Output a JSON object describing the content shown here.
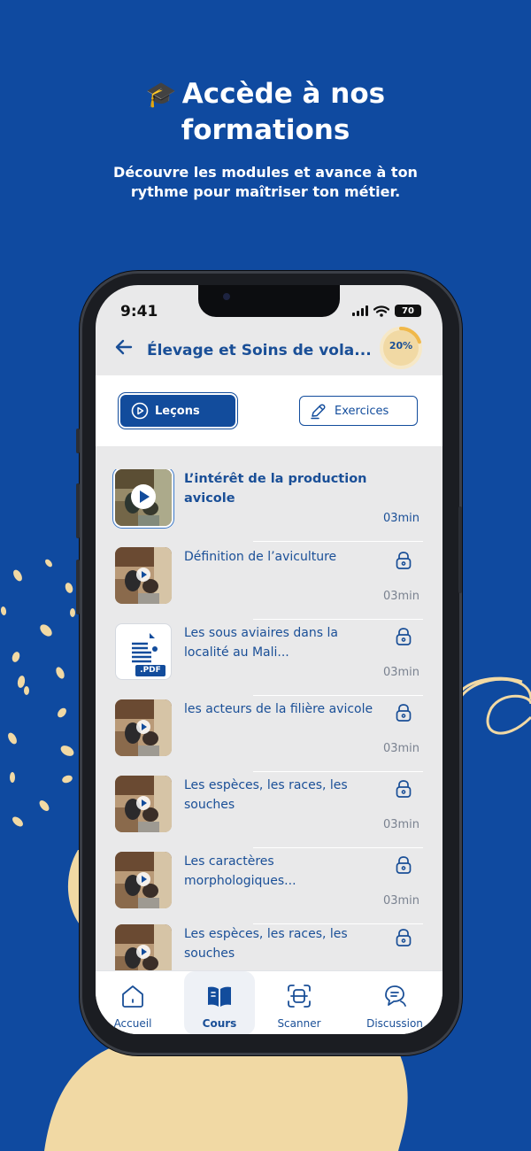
{
  "hero": {
    "icon": "graduation-cap-icon",
    "title_line1": "Accède à nos",
    "title_line2": "formations",
    "subtitle": "Découvre les modules et avance à ton rythme pour maîtriser ton métier."
  },
  "status_bar": {
    "time": "9:41",
    "battery": "70"
  },
  "header": {
    "back_icon": "arrow-left-icon",
    "title": "Élevage et Soins de vola...",
    "progress_label": "20%",
    "progress_value": 0.2
  },
  "tabs": [
    {
      "label": "Leçons",
      "icon": "play-circle-icon",
      "active": true
    },
    {
      "label": "Exercices",
      "icon": "pencil-icon",
      "active": false
    }
  ],
  "lessons": [
    {
      "title": "L’intérêt de la production avicole",
      "duration": "03min",
      "thumb": "video",
      "active": true,
      "locked": false
    },
    {
      "title": "Définition de l’aviculture",
      "duration": "03min",
      "thumb": "video",
      "active": false,
      "locked": true
    },
    {
      "title": "Les sous aviaires dans la localité au Mali...",
      "duration": "03min",
      "thumb": "pdf",
      "pdf_label": ".PDF",
      "active": false,
      "locked": true
    },
    {
      "title": "les acteurs de la filière avicole",
      "duration": "03min",
      "thumb": "video",
      "active": false,
      "locked": true
    },
    {
      "title": "Les espèces, les races, les souches",
      "duration": "03min",
      "thumb": "video",
      "active": false,
      "locked": true
    },
    {
      "title": "Les caractères morphologiques...",
      "duration": "03min",
      "thumb": "video",
      "active": false,
      "locked": true
    },
    {
      "title": "Les espèces, les races, les souches",
      "duration": "",
      "thumb": "video",
      "active": false,
      "locked": true
    }
  ],
  "bottom_nav": [
    {
      "label": "Accueil",
      "icon": "home-icon",
      "active": false
    },
    {
      "label": "Cours",
      "icon": "book-icon",
      "active": true
    },
    {
      "label": "Scanner",
      "icon": "scan-icon",
      "active": false
    },
    {
      "label": "Discussion",
      "icon": "chat-icon",
      "active": false
    }
  ],
  "colors": {
    "background": "#0f4aa0",
    "primary": "#124c9c",
    "accent_sand": "#f1d9a4",
    "screen_bg": "#e9e9ea"
  }
}
